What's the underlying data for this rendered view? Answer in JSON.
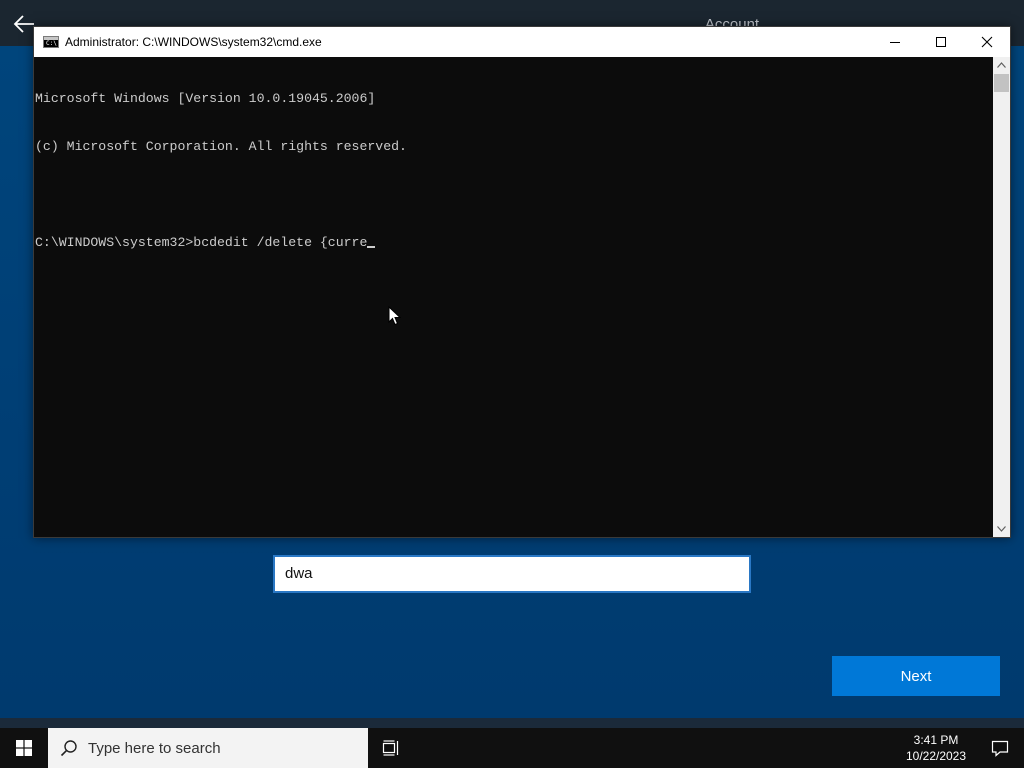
{
  "oobe": {
    "header_title": "Account",
    "name_input_value": "dwa",
    "next_label": "Next"
  },
  "cmd": {
    "title": "Administrator: C:\\WINDOWS\\system32\\cmd.exe",
    "icon_text": "C:\\",
    "lines": [
      "Microsoft Windows [Version 10.0.19045.2006]",
      "(c) Microsoft Corporation. All rights reserved.",
      "",
      "C:\\WINDOWS\\system32>bcdedit /delete {curre"
    ]
  },
  "taskbar": {
    "search_placeholder": "Type here to search",
    "time": "3:41 PM",
    "date": "10/22/2023"
  },
  "colors": {
    "oobe_background": "#003e74",
    "accent": "#0078d7",
    "console_background": "#0c0c0c",
    "console_text": "#cccccc",
    "taskbar": "#101010"
  },
  "icons": {
    "back": "back-arrow-icon",
    "minimize": "minimize-icon",
    "maximize": "maximize-icon",
    "close": "close-icon",
    "start": "windows-logo-icon",
    "search": "search-icon",
    "task_view": "task-view-icon",
    "notifications": "notification-icon"
  }
}
